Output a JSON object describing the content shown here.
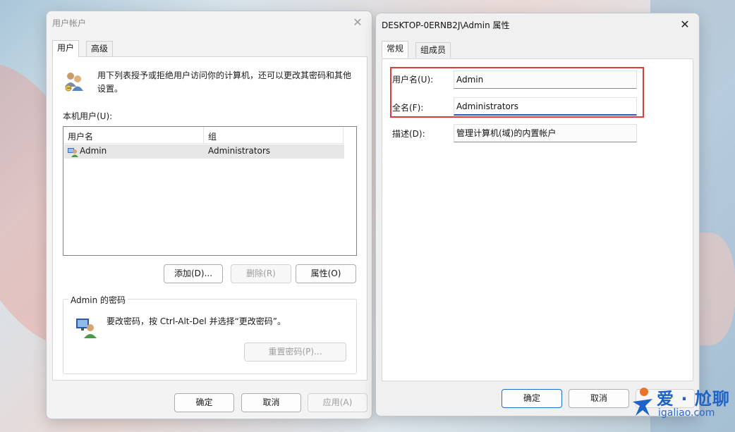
{
  "window1": {
    "title": "用户帐户",
    "tabs": [
      {
        "label": "用户",
        "active": true
      },
      {
        "label": "高级",
        "active": false
      }
    ],
    "intro_text": "用下列表授予或拒绝用户访问你的计算机，还可以更改其密码和其他设置。",
    "local_users_label": "本机用户(U):",
    "list": {
      "columns": [
        "用户名",
        "组"
      ],
      "rows": [
        {
          "username": "Admin",
          "group": "Administrators",
          "selected": true
        }
      ]
    },
    "buttons": {
      "add": "添加(D)...",
      "remove": "删除(R)",
      "properties": "属性(O)"
    },
    "password_group": {
      "title": "Admin 的密码",
      "text": "要改密码，按 Ctrl-Alt-Del 并选择“更改密码”。",
      "reset_button": "重置密码(P)..."
    },
    "footer": {
      "ok": "确定",
      "cancel": "取消",
      "apply": "应用(A)"
    }
  },
  "window2": {
    "title": "DESKTOP-0ERNB2J\\Admin 属性",
    "tabs": [
      {
        "label": "常规",
        "active": true
      },
      {
        "label": "组成员",
        "active": false
      }
    ],
    "fields": {
      "username_label": "用户名(U):",
      "username_value": "Admin",
      "fullname_label": "全名(F):",
      "fullname_value": "Administrators",
      "description_label": "描述(D):",
      "description_value": "管理计算机(域)的内置帐户"
    },
    "footer": {
      "ok": "确定",
      "cancel": "取消",
      "apply": "应"
    }
  },
  "watermark": {
    "name": "爱 · 尬聊",
    "url": "igaliao.com"
  },
  "colors": {
    "highlight_box": "#e03a3a",
    "focus_underline": "#1f5fbf",
    "primary_button_border": "#1a6fcf"
  }
}
